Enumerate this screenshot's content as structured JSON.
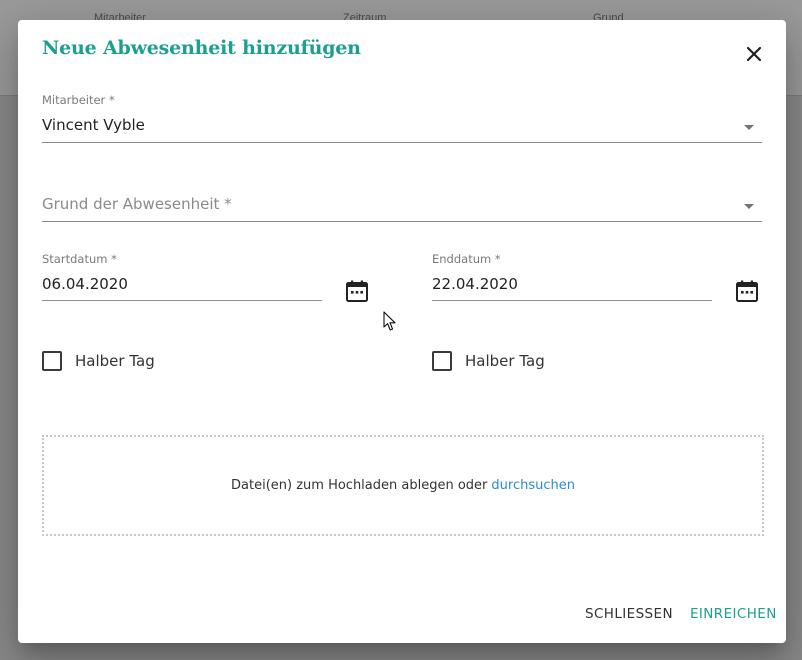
{
  "backdrop": {
    "columns": [
      "Mitarbeiter",
      "Zeitraum",
      "Grund"
    ]
  },
  "dialog": {
    "title": "Neue Abwesenheit hinzufügen",
    "close_icon": "close-icon",
    "employee": {
      "label": "Mitarbeiter *",
      "value": "Vincent Vyble"
    },
    "reason": {
      "placeholder": "Grund der Abwesenheit *"
    },
    "start_date": {
      "label": "Startdatum *",
      "value": "06.04.2020",
      "icon": "calendar-icon"
    },
    "end_date": {
      "label": "Enddatum *",
      "value": "22.04.2020",
      "icon": "calendar-icon"
    },
    "half_day_start": {
      "label": "Halber Tag",
      "checked": false
    },
    "half_day_end": {
      "label": "Halber Tag",
      "checked": false
    },
    "upload": {
      "text": "Datei(en) zum Hochladen ablegen oder",
      "link": "durchsuchen"
    },
    "actions": {
      "close": "SCHLIESSEN",
      "submit": "EINREICHEN"
    }
  },
  "colors": {
    "accent": "#1a9f90",
    "link": "#2a8bd6",
    "overlay": "#8a8a8a"
  }
}
